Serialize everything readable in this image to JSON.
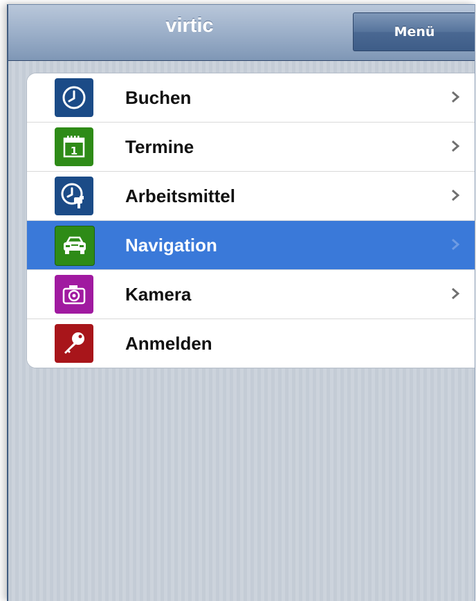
{
  "header": {
    "title": "virtic",
    "menu_label": "Menü"
  },
  "menu": {
    "items": [
      {
        "label": "Buchen",
        "icon": "clock-icon",
        "color": "#1b4b87",
        "chevron": true,
        "selected": false
      },
      {
        "label": "Termine",
        "icon": "calendar-icon",
        "color": "#2e8b17",
        "chevron": true,
        "selected": false
      },
      {
        "label": "Arbeitsmittel",
        "icon": "clock-tool-icon",
        "color": "#1b4b87",
        "chevron": true,
        "selected": false
      },
      {
        "label": "Navigation",
        "icon": "car-icon",
        "color": "#2e8b17",
        "chevron": true,
        "selected": true
      },
      {
        "label": "Kamera",
        "icon": "camera-icon",
        "color": "#a01aa0",
        "chevron": true,
        "selected": false
      },
      {
        "label": "Anmelden",
        "icon": "key-icon",
        "color": "#a8151a",
        "chevron": false,
        "selected": false
      }
    ]
  },
  "colors": {
    "selection": "#3a79d9",
    "header_text": "#ffffff"
  },
  "calendar_day": "1"
}
